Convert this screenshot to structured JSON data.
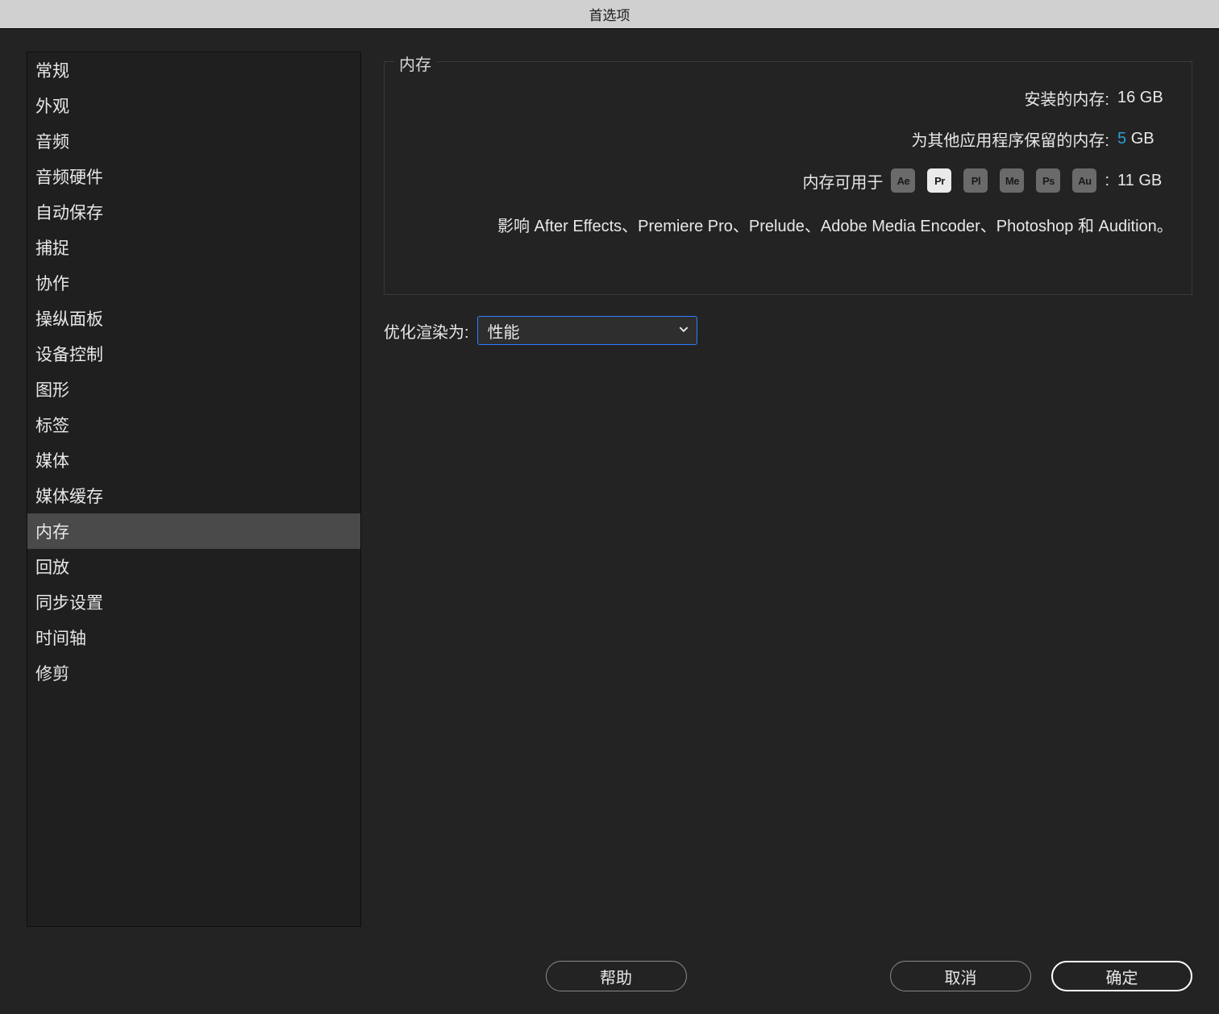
{
  "window": {
    "title": "首选项"
  },
  "sidebar": {
    "items": [
      {
        "label": "常规"
      },
      {
        "label": "外观"
      },
      {
        "label": "音频"
      },
      {
        "label": "音频硬件"
      },
      {
        "label": "自动保存"
      },
      {
        "label": "捕捉"
      },
      {
        "label": "协作"
      },
      {
        "label": "操纵面板"
      },
      {
        "label": "设备控制"
      },
      {
        "label": "图形"
      },
      {
        "label": "标签"
      },
      {
        "label": "媒体"
      },
      {
        "label": "媒体缓存"
      },
      {
        "label": "内存"
      },
      {
        "label": "回放"
      },
      {
        "label": "同步设置"
      },
      {
        "label": "时间轴"
      },
      {
        "label": "修剪"
      }
    ],
    "selected_index": 13
  },
  "memory": {
    "group_title": "内存",
    "installed_label": "安装的内存:",
    "installed_value": "16 GB",
    "reserved_label": "为其他应用程序保留的内存:",
    "reserved_value": "5",
    "reserved_unit": "GB",
    "available_label": "内存可用于",
    "available_value": "11 GB",
    "colon": ":",
    "apps": [
      {
        "code": "Ae",
        "active": false
      },
      {
        "code": "Pr",
        "active": true
      },
      {
        "code": "Pl",
        "active": false
      },
      {
        "code": "Me",
        "active": false
      },
      {
        "code": "Ps",
        "active": false
      },
      {
        "code": "Au",
        "active": false
      }
    ],
    "note": "影响 After Effects、Premiere Pro、Prelude、Adobe Media Encoder、Photoshop 和 Audition。"
  },
  "optimize": {
    "label": "优化渲染为:",
    "value": "性能"
  },
  "buttons": {
    "help": "帮助",
    "cancel": "取消",
    "ok": "确定"
  }
}
